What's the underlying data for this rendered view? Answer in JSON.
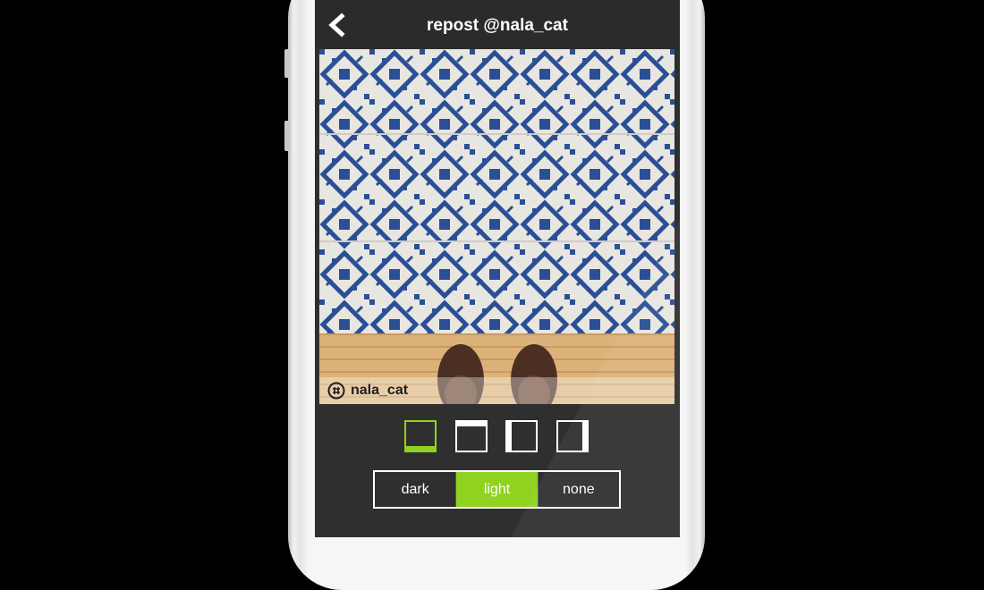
{
  "header": {
    "title": "repost @nala_cat",
    "back_icon": "chevron-left-icon"
  },
  "photo": {
    "description_icon": "photo",
    "watermark_user": "nala_cat",
    "watermark_icon": "repost-logo-icon"
  },
  "border_options": [
    {
      "name": "bottom-bar",
      "selected": true
    },
    {
      "name": "top-bar",
      "selected": false
    },
    {
      "name": "left-bar",
      "selected": false
    },
    {
      "name": "right-bar",
      "selected": false
    }
  ],
  "theme": {
    "options": [
      "dark",
      "light",
      "none"
    ],
    "selected": "light"
  },
  "colors": {
    "accent": "#8fd21f",
    "background": "#2f2f2f",
    "text": "#ffffff"
  }
}
